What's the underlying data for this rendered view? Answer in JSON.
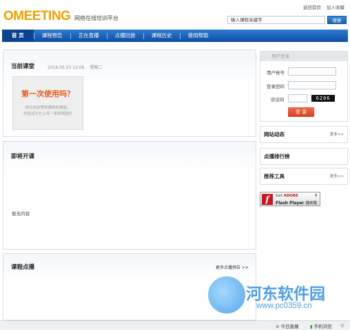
{
  "header": {
    "logo": "OMEETING",
    "slogan": "网络在线培训平台",
    "top_links": [
      "返回首页",
      "加入收藏"
    ],
    "search_placeholder": "输入课程关键字",
    "search_button": "搜索"
  },
  "nav": {
    "items": [
      "首 页",
      "课程预告",
      "正在直播",
      "点播回放",
      "课程历史",
      "使用帮助"
    ],
    "active_index": 0
  },
  "current_class": {
    "title": "当前课堂",
    "date": "2016.05.03 12:06",
    "weekday": "星期二",
    "first_use_title": "第一次使用吗？",
    "first_use_line1": "请点击这里创建新的课堂，",
    "first_use_line2": "并尝试为它上传一条封面图片"
  },
  "upcoming": {
    "title": "即将开课",
    "empty_text": "暂无内容"
  },
  "vod": {
    "title": "课程点播",
    "more": "更多点播预告 >>"
  },
  "login": {
    "title": "用户登录",
    "username_label": "用户帐号",
    "password_label": "登录密码",
    "captcha_label": "验证码",
    "captcha_code": "6206",
    "submit": "登 录"
  },
  "sidebar": {
    "site_news": {
      "title": "网站动态",
      "more": "更多>>"
    },
    "ranking": {
      "title": "点播排行榜"
    },
    "tools": {
      "title": "推荐工具",
      "more": "更多>>"
    }
  },
  "flash": {
    "get": "Get",
    "adobe": "ADOBE",
    "product": "Flash Player",
    "product_cn": "播放器"
  },
  "watermark": {
    "text": "河东软件园",
    "url": "www.pc0359.cn"
  },
  "statusbar": {
    "live": "今日直播",
    "mobile": "手机浏览"
  }
}
